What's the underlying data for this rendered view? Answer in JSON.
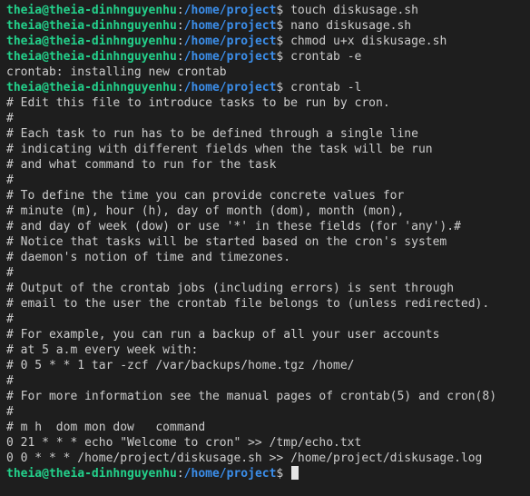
{
  "terminal": {
    "prompt": {
      "user_host": "theia@theia-dinhnguyenhu",
      "colon": ":",
      "path": "/home/project",
      "dollar": "$ "
    },
    "lines": [
      {
        "kind": "prompt",
        "command": "touch diskusage.sh"
      },
      {
        "kind": "prompt",
        "command": "nano diskusage.sh"
      },
      {
        "kind": "prompt",
        "command": "chmod u+x diskusage.sh"
      },
      {
        "kind": "prompt",
        "command": "crontab -e"
      },
      {
        "kind": "output",
        "text": "crontab: installing new crontab"
      },
      {
        "kind": "prompt",
        "command": "crontab -l"
      },
      {
        "kind": "output",
        "text": "# Edit this file to introduce tasks to be run by cron."
      },
      {
        "kind": "output",
        "text": "#"
      },
      {
        "kind": "output",
        "text": "# Each task to run has to be defined through a single line"
      },
      {
        "kind": "output",
        "text": "# indicating with different fields when the task will be run"
      },
      {
        "kind": "output",
        "text": "# and what command to run for the task"
      },
      {
        "kind": "output",
        "text": "#"
      },
      {
        "kind": "output",
        "text": "# To define the time you can provide concrete values for"
      },
      {
        "kind": "output",
        "text": "# minute (m), hour (h), day of month (dom), month (mon),"
      },
      {
        "kind": "output",
        "text": "# and day of week (dow) or use '*' in these fields (for 'any').#"
      },
      {
        "kind": "output",
        "text": "# Notice that tasks will be started based on the cron's system"
      },
      {
        "kind": "output",
        "text": "# daemon's notion of time and timezones."
      },
      {
        "kind": "output",
        "text": "#"
      },
      {
        "kind": "output",
        "text": "# Output of the crontab jobs (including errors) is sent through"
      },
      {
        "kind": "output",
        "text": "# email to the user the crontab file belongs to (unless redirected)."
      },
      {
        "kind": "output",
        "text": "#"
      },
      {
        "kind": "output",
        "text": "# For example, you can run a backup of all your user accounts"
      },
      {
        "kind": "output",
        "text": "# at 5 a.m every week with:"
      },
      {
        "kind": "output",
        "text": "# 0 5 * * 1 tar -zcf /var/backups/home.tgz /home/"
      },
      {
        "kind": "output",
        "text": "#"
      },
      {
        "kind": "output",
        "text": "# For more information see the manual pages of crontab(5) and cron(8)"
      },
      {
        "kind": "output",
        "text": "#"
      },
      {
        "kind": "output",
        "text": "# m h  dom mon dow   command"
      },
      {
        "kind": "output",
        "text": "0 21 * * * echo \"Welcome to cron\" >> /tmp/echo.txt"
      },
      {
        "kind": "output",
        "text": "0 0 * * * /home/project/diskusage.sh >> /home/project/diskusage.log"
      },
      {
        "kind": "prompt",
        "command": "",
        "cursor": true
      }
    ]
  },
  "colors": {
    "background": "#1e1e1e",
    "user_host": "#23d18b",
    "path": "#3b8eea",
    "text": "#cccccc"
  }
}
